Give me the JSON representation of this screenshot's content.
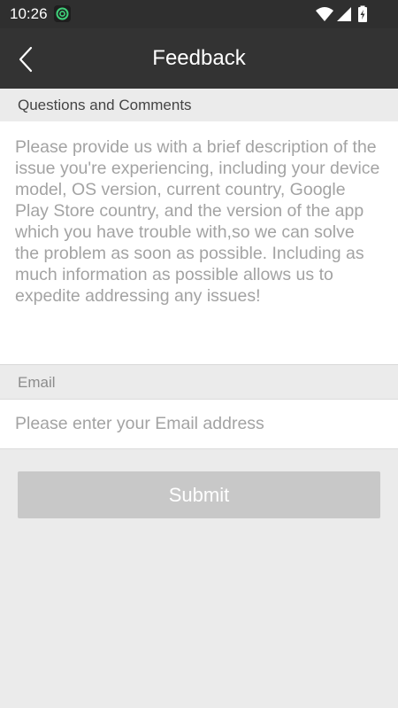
{
  "status_bar": {
    "time": "10:26",
    "app_icon": "green-circular-app-icon",
    "icons": [
      "wifi-icon",
      "cellular-signal-icon",
      "battery-charging-icon"
    ],
    "background_color": "#2f2f2f"
  },
  "app_bar": {
    "title": "Feedback",
    "back_icon": "chevron-left-icon",
    "background_color": "#333333"
  },
  "questions_section": {
    "label": "Questions and Comments",
    "placeholder": "Please provide us with a brief description of the issue you're experiencing, including your device model, OS version, current country, Google Play Store country, and the version of the app which you have trouble with,so we can solve the problem as soon as possible. Including as much information as possible allows us to expedite addressing any issues!",
    "value": ""
  },
  "email_section": {
    "label": "Email",
    "placeholder": "Please enter your Email address",
    "value": ""
  },
  "submit": {
    "label": "Submit",
    "state": "disabled",
    "background_color": "#c8c8c8"
  },
  "colors": {
    "page_background": "#ebebeb",
    "panel_background": "#ffffff",
    "placeholder_text": "#a3a3a3",
    "accent_green": "#3fd07a"
  }
}
